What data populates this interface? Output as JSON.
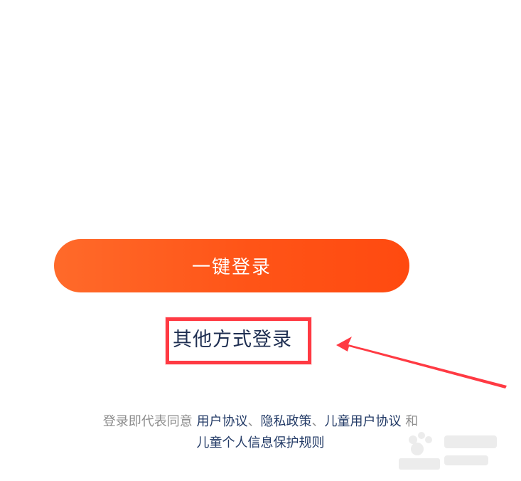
{
  "primary_action": {
    "one_click_login_label": "一键登录"
  },
  "secondary_action": {
    "other_login_label": "其他方式登录"
  },
  "agreement": {
    "prefix": "登录即代表同意",
    "user_agreement": "用户协议",
    "separator_1": "、",
    "privacy_policy": "隐私政策",
    "separator_2": "、",
    "child_user_agreement": "儿童用户协议",
    "and": " 和",
    "child_privacy_rules": "儿童个人信息保护规则"
  },
  "colors": {
    "button_orange": "#ff5417",
    "highlight_red": "#ff3a43",
    "link_navy": "#223a66",
    "muted_gray": "#8d8d8d"
  },
  "icons": {
    "arrow": "red-pointer-arrow-icon"
  }
}
